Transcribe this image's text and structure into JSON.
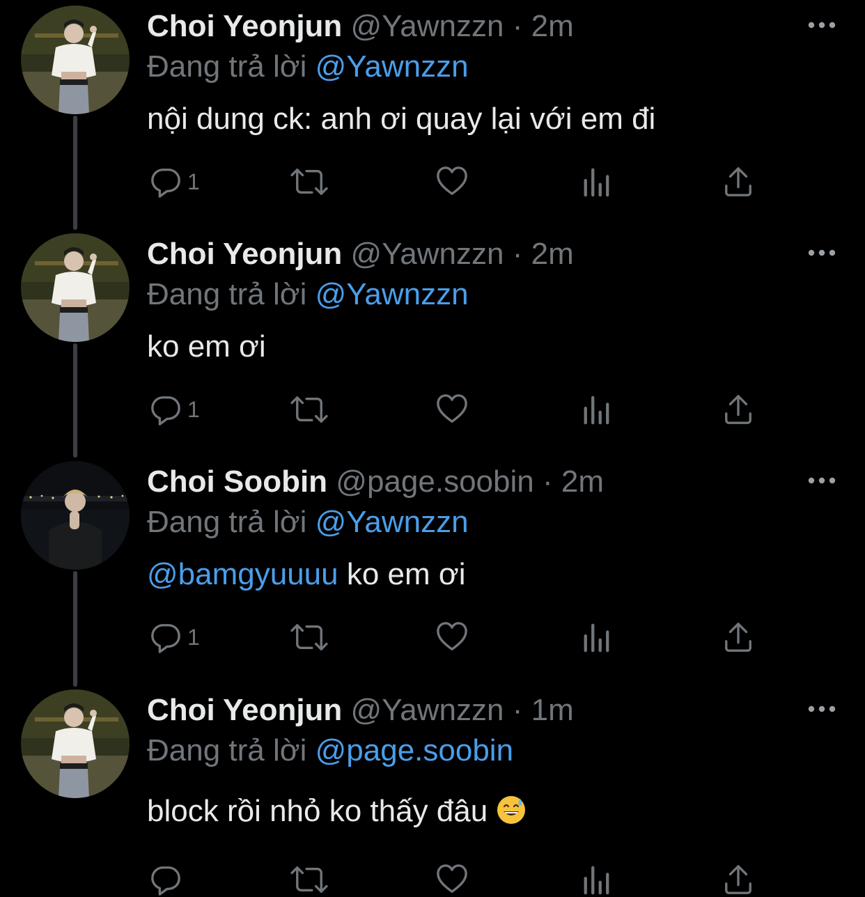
{
  "tweets": [
    {
      "name": "Choi Yeonjun",
      "handle": "@Yawnzzn",
      "dot": "·",
      "time": "2m",
      "reply_label": "Đang trả lời",
      "reply_to": "@Yawnzzn",
      "text": "nội dung ck: anh ơi quay lại với em đi",
      "reply_count": "1",
      "avatar": "person-avatar-yeonjun"
    },
    {
      "name": "Choi Yeonjun",
      "handle": "@Yawnzzn",
      "dot": "·",
      "time": "2m",
      "reply_label": "Đang trả lời",
      "reply_to": "@Yawnzzn",
      "text": "ko em ơi",
      "reply_count": "1",
      "avatar": "person-avatar-yeonjun"
    },
    {
      "name": "Choi Soobin",
      "handle": "@page.soobin",
      "dot": "·",
      "time": "2m",
      "reply_label": "Đang trả lời",
      "reply_to": "@Yawnzzn",
      "text_mention": "@bamgyuuuu",
      "text": "ko em ơi",
      "reply_count": "1",
      "avatar": "person-avatar-soobin"
    },
    {
      "name": "Choi Yeonjun",
      "handle": "@Yawnzzn",
      "dot": "·",
      "time": "1m",
      "reply_label": "Đang trả lời",
      "reply_to": "@page.soobin",
      "text": "block rồi nhỏ ko thấy đâu",
      "emoji": "grinning-sweat-emoji",
      "reply_count": "",
      "avatar": "person-avatar-yeonjun"
    }
  ],
  "icons": {
    "reply": "speech-bubble-icon",
    "retweet": "retweet-icon",
    "like": "heart-icon",
    "views": "bar-chart-icon",
    "share": "share-icon",
    "more": "more-dots-icon"
  },
  "colors": {
    "background": "#000000",
    "text_primary": "#e7e9ea",
    "text_secondary": "#71767b",
    "accent": "#4a9eea",
    "thread_line": "#3b3f44"
  }
}
